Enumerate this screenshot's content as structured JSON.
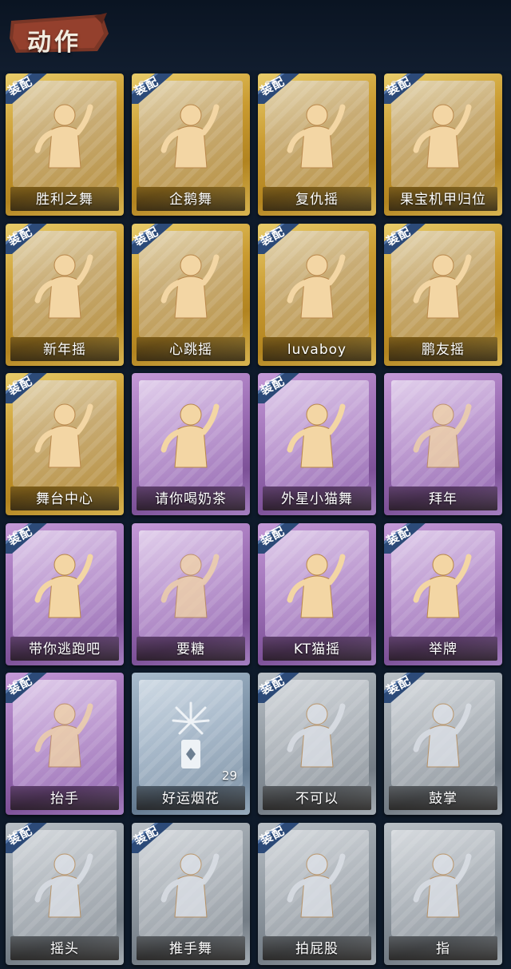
{
  "header": {
    "title": "动作"
  },
  "equip_tag": "装配",
  "rarity_colors": {
    "gold": "#c99a30",
    "purple": "#9a6cb3",
    "silver": "#8e979f",
    "blue": "#7d93a8"
  },
  "cards": [
    {
      "name": "胜利之舞",
      "rarity": "gold",
      "equipped": true,
      "icon": "victory-dance-icon"
    },
    {
      "name": "企鹅舞",
      "rarity": "gold",
      "equipped": true,
      "icon": "penguin-dance-icon"
    },
    {
      "name": "复仇摇",
      "rarity": "gold",
      "equipped": true,
      "icon": "revenge-shake-icon"
    },
    {
      "name": "果宝机甲归位",
      "rarity": "gold",
      "equipped": true,
      "icon": "mecha-pose-icon"
    },
    {
      "name": "新年摇",
      "rarity": "gold",
      "equipped": true,
      "icon": "new-year-shake-icon"
    },
    {
      "name": "心跳摇",
      "rarity": "gold",
      "equipped": true,
      "icon": "heartbeat-shake-icon"
    },
    {
      "name": "luvaboy",
      "rarity": "gold",
      "equipped": true,
      "icon": "luvaboy-icon"
    },
    {
      "name": "鹏友摇",
      "rarity": "gold",
      "equipped": true,
      "icon": "friend-shake-icon"
    },
    {
      "name": "舞台中心",
      "rarity": "gold",
      "equipped": true,
      "icon": "stage-center-icon"
    },
    {
      "name": "请你喝奶茶",
      "rarity": "purple",
      "equipped": false,
      "icon": "milk-tea-icon"
    },
    {
      "name": "外星小猫舞",
      "rarity": "purple",
      "equipped": true,
      "icon": "alien-cat-dance-icon"
    },
    {
      "name": "拜年",
      "rarity": "purple",
      "equipped": false,
      "icon": "new-year-greeting-icon"
    },
    {
      "name": "带你逃跑吧",
      "rarity": "purple",
      "equipped": true,
      "icon": "run-away-icon"
    },
    {
      "name": "要糖",
      "rarity": "purple",
      "equipped": false,
      "icon": "ask-candy-icon"
    },
    {
      "name": "KT猫摇",
      "rarity": "purple",
      "equipped": true,
      "icon": "kt-cat-shake-icon"
    },
    {
      "name": "举牌",
      "rarity": "purple",
      "equipped": true,
      "icon": "hold-sign-icon"
    },
    {
      "name": "抬手",
      "rarity": "purple",
      "equipped": true,
      "icon": "raise-hand-icon"
    },
    {
      "name": "好运烟花",
      "rarity": "blue",
      "equipped": false,
      "icon": "firework-icon",
      "count": "29"
    },
    {
      "name": "不可以",
      "rarity": "silver",
      "equipped": true,
      "icon": "no-finger-icon"
    },
    {
      "name": "鼓掌",
      "rarity": "silver",
      "equipped": true,
      "icon": "clap-icon"
    },
    {
      "name": "摇头",
      "rarity": "silver",
      "equipped": true,
      "icon": "shake-head-icon"
    },
    {
      "name": "推手舞",
      "rarity": "silver",
      "equipped": true,
      "icon": "push-hand-dance-icon"
    },
    {
      "name": "拍屁股",
      "rarity": "silver",
      "equipped": true,
      "icon": "pat-butt-icon"
    },
    {
      "name": "指",
      "rarity": "silver",
      "equipped": false,
      "icon": "point-icon"
    }
  ]
}
